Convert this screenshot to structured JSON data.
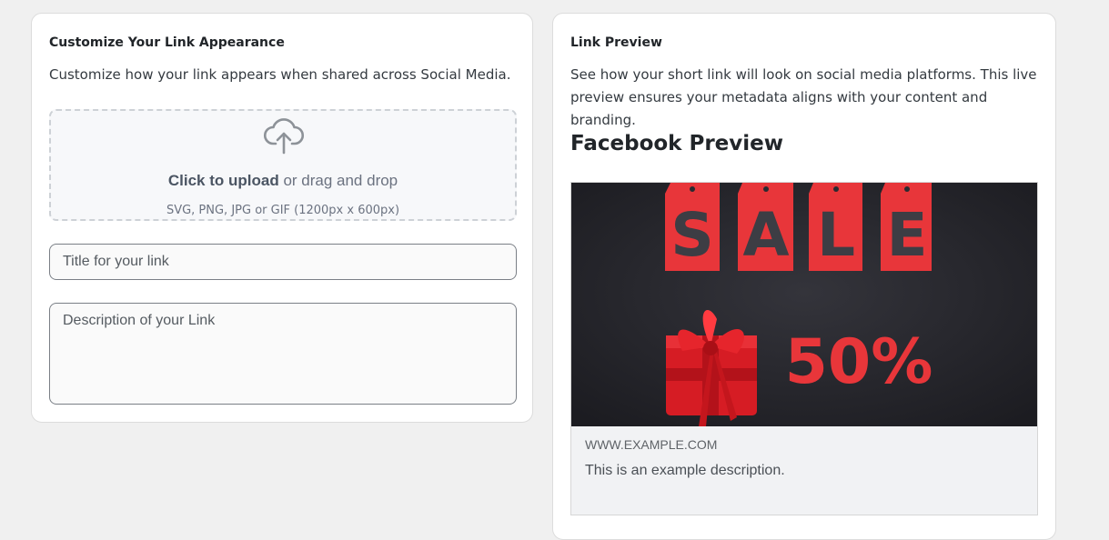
{
  "customize": {
    "title": "Customize Your Link Appearance",
    "description": "Customize how your link appears when shared across Social Media.",
    "upload": {
      "icon": "cloud-upload-icon",
      "action": "Click to upload",
      "alt": "or drag and drop",
      "hint": "SVG, PNG, JPG or GIF (1200px x 600px)"
    },
    "title_placeholder": "Title for your link",
    "title_value": "",
    "description_placeholder": "Description of your Link",
    "description_value": ""
  },
  "preview": {
    "title": "Link Preview",
    "description": "See how your short link will look on social media platforms. This live preview ensures your metadata aligns with your content and branding.",
    "facebook": {
      "heading": "Facebook Preview",
      "image": {
        "sale_letters": [
          "S",
          "A",
          "L",
          "E"
        ],
        "discount": "50%"
      },
      "domain": "WWW.EXAMPLE.COM",
      "description": "This is an example description."
    }
  },
  "colors": {
    "page_bg": "#f0f0f0",
    "card_bg": "#ffffff",
    "sale_red": "#e8363a",
    "image_bg": "#25252b"
  }
}
